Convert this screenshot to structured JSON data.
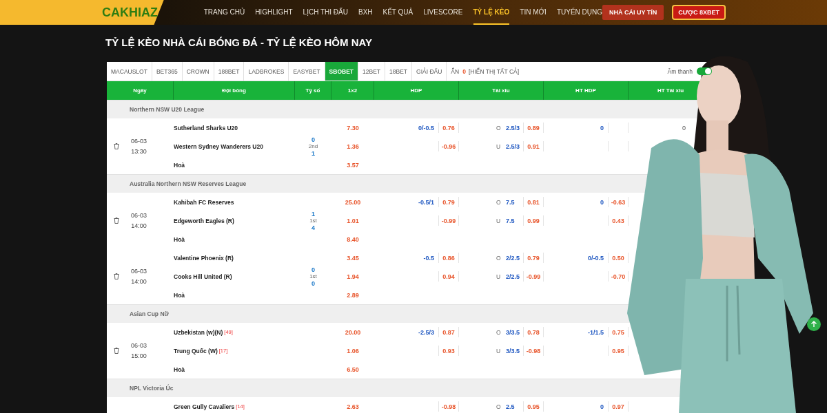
{
  "header": {
    "logo": "CAKHIAZ",
    "nav": [
      {
        "label": "TRANG CHỦ",
        "selected": false
      },
      {
        "label": "HIGHLIGHT",
        "selected": false
      },
      {
        "label": "LỊCH THI ĐẤU",
        "selected": false
      },
      {
        "label": "BXH",
        "selected": false
      },
      {
        "label": "KẾT QUẢ",
        "selected": false
      },
      {
        "label": "LIVESCORE",
        "selected": false
      },
      {
        "label": "TỶ LỆ KÈO",
        "selected": true
      },
      {
        "label": "TIN MỚI",
        "selected": false
      },
      {
        "label": "TUYỂN DỤNG",
        "selected": false
      }
    ],
    "buttons": [
      {
        "label": "NHÀ CÁI UY TÍN",
        "kind": "plain"
      },
      {
        "label": "CƯỢC 8XBET",
        "kind": "outlined"
      }
    ]
  },
  "page_title": "TỶ LỆ KÈO NHÀ CÁI BÓNG ĐÁ - TỶ LỆ KÈO HÔM NAY",
  "tabs": [
    {
      "label": "MACAUSLOT",
      "selected": false
    },
    {
      "label": "BET365",
      "selected": false
    },
    {
      "label": "CROWN",
      "selected": false
    },
    {
      "label": "188BET",
      "selected": false
    },
    {
      "label": "LADBROKES",
      "selected": false
    },
    {
      "label": "EASYBET",
      "selected": false
    },
    {
      "label": "SBOBET",
      "selected": true
    },
    {
      "label": "12BET",
      "selected": false
    },
    {
      "label": "18BET",
      "selected": false
    },
    {
      "label": "GIẢI ĐẤU",
      "selected": false
    }
  ],
  "hidden": {
    "label": "ẨN",
    "count": "0",
    "link": "[HIỂN THỊ TẤT CẢ]"
  },
  "sound": {
    "label": "Âm thanh",
    "on": true
  },
  "table": {
    "columns": [
      "Ngày",
      "Đội bóng",
      "Tỷ số",
      "1x2",
      "HDP",
      "Tài xỉu",
      "HT HDP",
      "HT Tài xỉu"
    ],
    "leagues": [
      {
        "name": "Northern NSW U20 League",
        "matches": [
          {
            "date": "06-03",
            "time": "13:30",
            "score": [
              "0",
              "2nd",
              "1"
            ],
            "lines": [
              {
                "kind": "team",
                "team": "Sutherland Sharks U20",
                "x12": "7.30",
                "hdp_line": "0/-0.5",
                "hdp_odds": "0.76",
                "ou_side": "O",
                "ou_line": "2.5/3",
                "ou_odds": "0.89",
                "ht_line": "0",
                "htou_line": "0"
              },
              {
                "kind": "team",
                "team": "Western Sydney Wanderers U20",
                "x12": "1.36",
                "hdp_odds": "-0.96",
                "ou_side": "U",
                "ou_line": "2.5/3",
                "ou_odds": "0.91"
              },
              {
                "kind": "draw",
                "team": "Hoà",
                "x12": "3.57"
              }
            ]
          }
        ]
      },
      {
        "name": "Australia Northern NSW Reserves League",
        "matches": [
          {
            "date": "06-03",
            "time": "14:00",
            "score": [
              "1",
              "1st",
              "4"
            ],
            "lines": [
              {
                "kind": "team",
                "team": "Kahibah FC Reserves",
                "x12": "25.00",
                "hdp_line": "-0.5/1",
                "hdp_odds": "0.79",
                "ou_side": "O",
                "ou_line": "7.5",
                "ou_odds": "0.81",
                "ht_line": "0",
                "ht_odds": "-0.63"
              },
              {
                "kind": "team",
                "team": "Edgeworth Eagles (R)",
                "x12": "1.01",
                "hdp_odds": "-0.99",
                "ou_side": "U",
                "ou_line": "7.5",
                "ou_odds": "0.99",
                "ht_odds": "0.43"
              },
              {
                "kind": "draw",
                "team": "Hoà",
                "x12": "8.40"
              }
            ]
          },
          {
            "date": "06-03",
            "time": "14:00",
            "score": [
              "0",
              "1st",
              "0"
            ],
            "lines": [
              {
                "kind": "team",
                "team": "Valentine Phoenix (R)",
                "x12": "3.45",
                "hdp_line": "-0.5",
                "hdp_odds": "0.86",
                "ou_side": "O",
                "ou_line": "2/2.5",
                "ou_odds": "0.79",
                "ht_line": "0/-0.5",
                "ht_odds": "0.50"
              },
              {
                "kind": "team",
                "team": "Cooks Hill United (R)",
                "x12": "1.94",
                "hdp_odds": "0.94",
                "ou_side": "U",
                "ou_line": "2/2.5",
                "ou_odds": "-0.99",
                "ht_odds": "-0.70"
              },
              {
                "kind": "draw",
                "team": "Hoà",
                "x12": "2.89"
              }
            ]
          }
        ]
      },
      {
        "name": "Asian Cup Nữ",
        "matches": [
          {
            "date": "06-03",
            "time": "15:00",
            "lines": [
              {
                "kind": "team",
                "team": "Uzbekistan (w)(N)",
                "rank": "[49]",
                "x12": "20.00",
                "hdp_line": "-2.5/3",
                "hdp_odds": "0.87",
                "ou_side": "O",
                "ou_line": "3/3.5",
                "ou_odds": "0.78",
                "ht_line": "-1/1.5",
                "ht_odds": "0.75"
              },
              {
                "kind": "team",
                "team": "Trung Quốc (W)",
                "rank": "[17]",
                "x12": "1.06",
                "hdp_odds": "0.93",
                "ou_side": "U",
                "ou_line": "3/3.5",
                "ou_odds": "-0.98",
                "ht_odds": "0.95"
              },
              {
                "kind": "draw",
                "team": "Hoà",
                "x12": "6.50"
              }
            ]
          }
        ]
      },
      {
        "name": "NPL Victoria Úc",
        "matches": [
          {
            "lines": [
              {
                "kind": "team",
                "team": "Green Gully Cavaliers",
                "rank": "[14]",
                "x12": "2.63",
                "hdp_odds": "-0.98",
                "ou_side": "O",
                "ou_line": "2.5",
                "ou_odds": "0.95",
                "ht_line": "0",
                "ht_odds": "0.97"
              }
            ]
          }
        ]
      }
    ]
  }
}
